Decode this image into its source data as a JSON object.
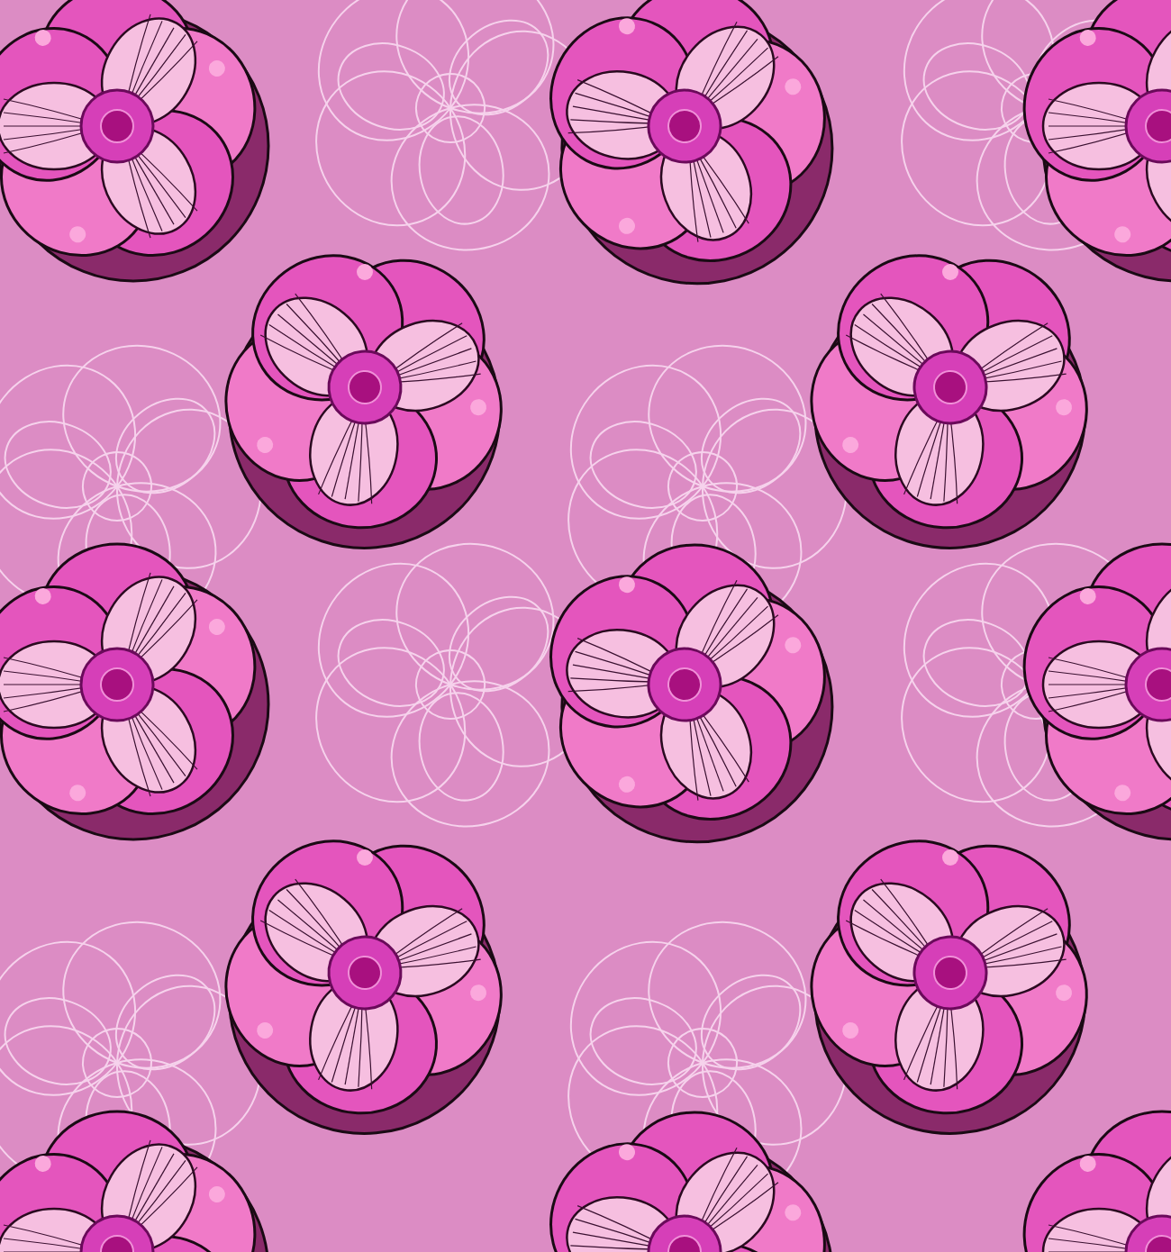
{
  "artwork": {
    "kind": "floral-pattern"
  }
}
